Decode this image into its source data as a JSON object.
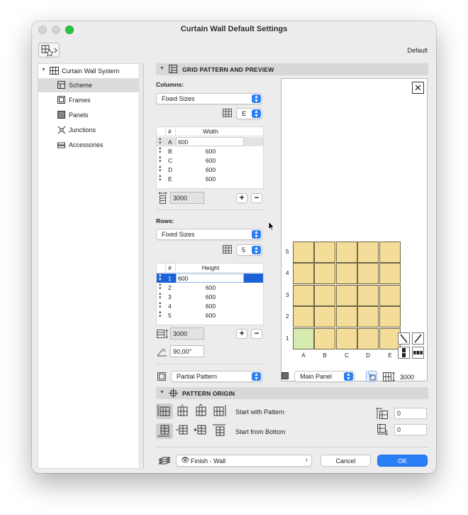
{
  "window": {
    "title": "Curtain Wall Default Settings",
    "default_label": "Default"
  },
  "sidebar": {
    "items": [
      {
        "label": "Curtain Wall System",
        "icon": "grid-system-icon"
      },
      {
        "label": "Scheme",
        "icon": "scheme-icon"
      },
      {
        "label": "Frames",
        "icon": "frames-icon"
      },
      {
        "label": "Panels",
        "icon": "panels-icon"
      },
      {
        "label": "Junctions",
        "icon": "junctions-icon"
      },
      {
        "label": "Accessories",
        "icon": "accessories-icon"
      }
    ],
    "selected": "Scheme"
  },
  "grid_section": {
    "title": "GRID PATTERN AND PREVIEW",
    "columns_label": "Columns:",
    "columns_mode": "Fixed Sizes",
    "columns_count": "E",
    "columns_table": {
      "headers": [
        "#",
        "Width"
      ],
      "rows": [
        {
          "id": "A",
          "value": "600"
        },
        {
          "id": "B",
          "value": "600"
        },
        {
          "id": "C",
          "value": "600"
        },
        {
          "id": "D",
          "value": "600"
        },
        {
          "id": "E",
          "value": "600"
        }
      ]
    },
    "columns_total": "3000",
    "rows_label": "Rows:",
    "rows_mode": "Fixed Sizes",
    "rows_count": "5",
    "rows_table": {
      "headers": [
        "#",
        "Height"
      ],
      "rows": [
        {
          "id": "1",
          "value": "600"
        },
        {
          "id": "2",
          "value": "600"
        },
        {
          "id": "3",
          "value": "600"
        },
        {
          "id": "4",
          "value": "600"
        },
        {
          "id": "5",
          "value": "600"
        }
      ]
    },
    "rows_total": "3000",
    "angle": "90,00°",
    "pattern_type": "Partial Pattern",
    "panel_type": "Main Panel",
    "height_value": "3000",
    "plus_label": "+",
    "minus_label": "−"
  },
  "preview": {
    "col_labels": [
      "A",
      "B",
      "C",
      "D",
      "E"
    ],
    "row_labels": [
      "5",
      "4",
      "3",
      "2",
      "1"
    ],
    "panel_color": "#f4dc99",
    "selected_panel_color": "#d6ebb0",
    "close_glyph": "✕"
  },
  "origin_section": {
    "title": "PATTERN ORIGIN",
    "start_with_pattern": "Start with Pattern",
    "start_from_bottom": "Start from Bottom",
    "offset_x": "0",
    "offset_y": "0"
  },
  "footer": {
    "finish": "Finish - Wall",
    "cancel": "Cancel",
    "ok": "OK"
  },
  "colors": {
    "accent": "#2a7ef6",
    "close": "#ff5f57",
    "minimize": "#febc2e",
    "zoom": "#28c840"
  }
}
